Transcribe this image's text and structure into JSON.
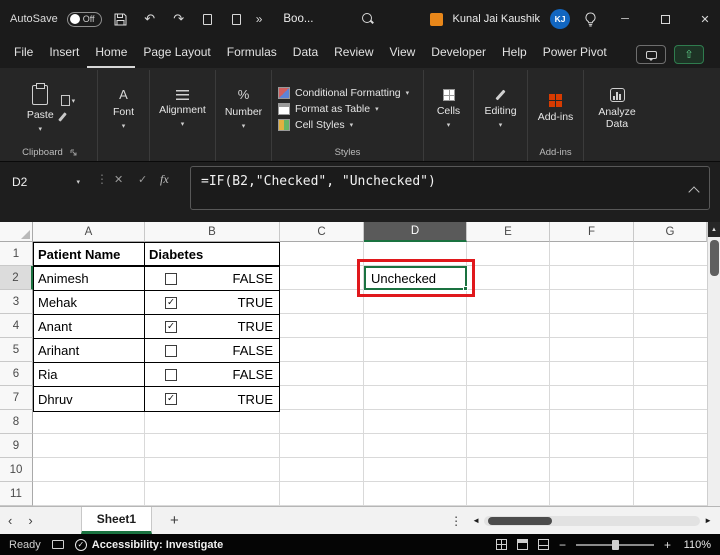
{
  "title_bar": {
    "autosave_label": "AutoSave",
    "autosave_state": "Off",
    "doc_title": "Boo...",
    "user_name": "Kunal Jai Kaushik",
    "user_initials": "KJ"
  },
  "menu": {
    "items": [
      "File",
      "Insert",
      "Home",
      "Page Layout",
      "Formulas",
      "Data",
      "Review",
      "View",
      "Developer",
      "Help",
      "Power Pivot"
    ],
    "active_item": "Home"
  },
  "ribbon": {
    "paste": "Paste",
    "clipboard_group": "Clipboard",
    "font": "Font",
    "alignment": "Alignment",
    "number": "Number",
    "conditional_formatting": "Conditional Formatting",
    "format_as_table": "Format as Table",
    "cell_styles": "Cell Styles",
    "styles_group": "Styles",
    "cells": "Cells",
    "editing": "Editing",
    "addins": "Add-ins",
    "addins_group": "Add-ins",
    "analyze_data": "Analyze Data"
  },
  "formula_bar": {
    "name_box": "D2",
    "formula": "=IF(B2,\"Checked\", \"Unchecked\")"
  },
  "grid": {
    "col_headers": [
      "A",
      "B",
      "C",
      "D",
      "E",
      "F",
      "G"
    ],
    "row_headers": [
      "1",
      "2",
      "3",
      "4",
      "5",
      "6",
      "7",
      "8",
      "9",
      "10",
      "11"
    ],
    "selected_col": "D",
    "selected_row": "2",
    "table": {
      "col_a_header": "Patient Name",
      "col_b_header": "Diabetes",
      "rows": [
        {
          "name": "Animesh",
          "check": "",
          "value": "FALSE"
        },
        {
          "name": "Mehak",
          "check": "✓",
          "value": "TRUE"
        },
        {
          "name": "Anant",
          "check": "✓",
          "value": "TRUE"
        },
        {
          "name": "Arihant",
          "check": "",
          "value": "FALSE"
        },
        {
          "name": "Ria",
          "check": "",
          "value": "FALSE"
        },
        {
          "name": "Dhruv",
          "check": "✓",
          "value": "TRUE"
        }
      ]
    },
    "active_cell_value": "Unchecked"
  },
  "sheet_bar": {
    "tab": "Sheet1"
  },
  "status_bar": {
    "mode": "Ready",
    "accessibility": "Accessibility: Investigate",
    "zoom": "110%"
  },
  "icons": {
    "dropdown": "▾",
    "overflow": "»",
    "undo": "↶",
    "redo": "↷",
    "more": "⋮",
    "cancel": "✕",
    "enter": "✓",
    "fx": "fx",
    "acc_check": "✓",
    "nav_left": "‹",
    "nav_right": "›",
    "add_sheet": "+",
    "scroll_left": "◄",
    "scroll_right": "►",
    "scroll_up": "▲",
    "minimize": "─",
    "close": "✕",
    "zoom_out": "−",
    "zoom_in": "+",
    "percent": "%",
    "font_letter": "A",
    "share_arrow": "⇧"
  },
  "colors": {
    "accent_green": "#1A7240",
    "annotation_red": "#E0181C",
    "avatar_blue": "#1266C0",
    "addins_orange": "#D83B01"
  }
}
